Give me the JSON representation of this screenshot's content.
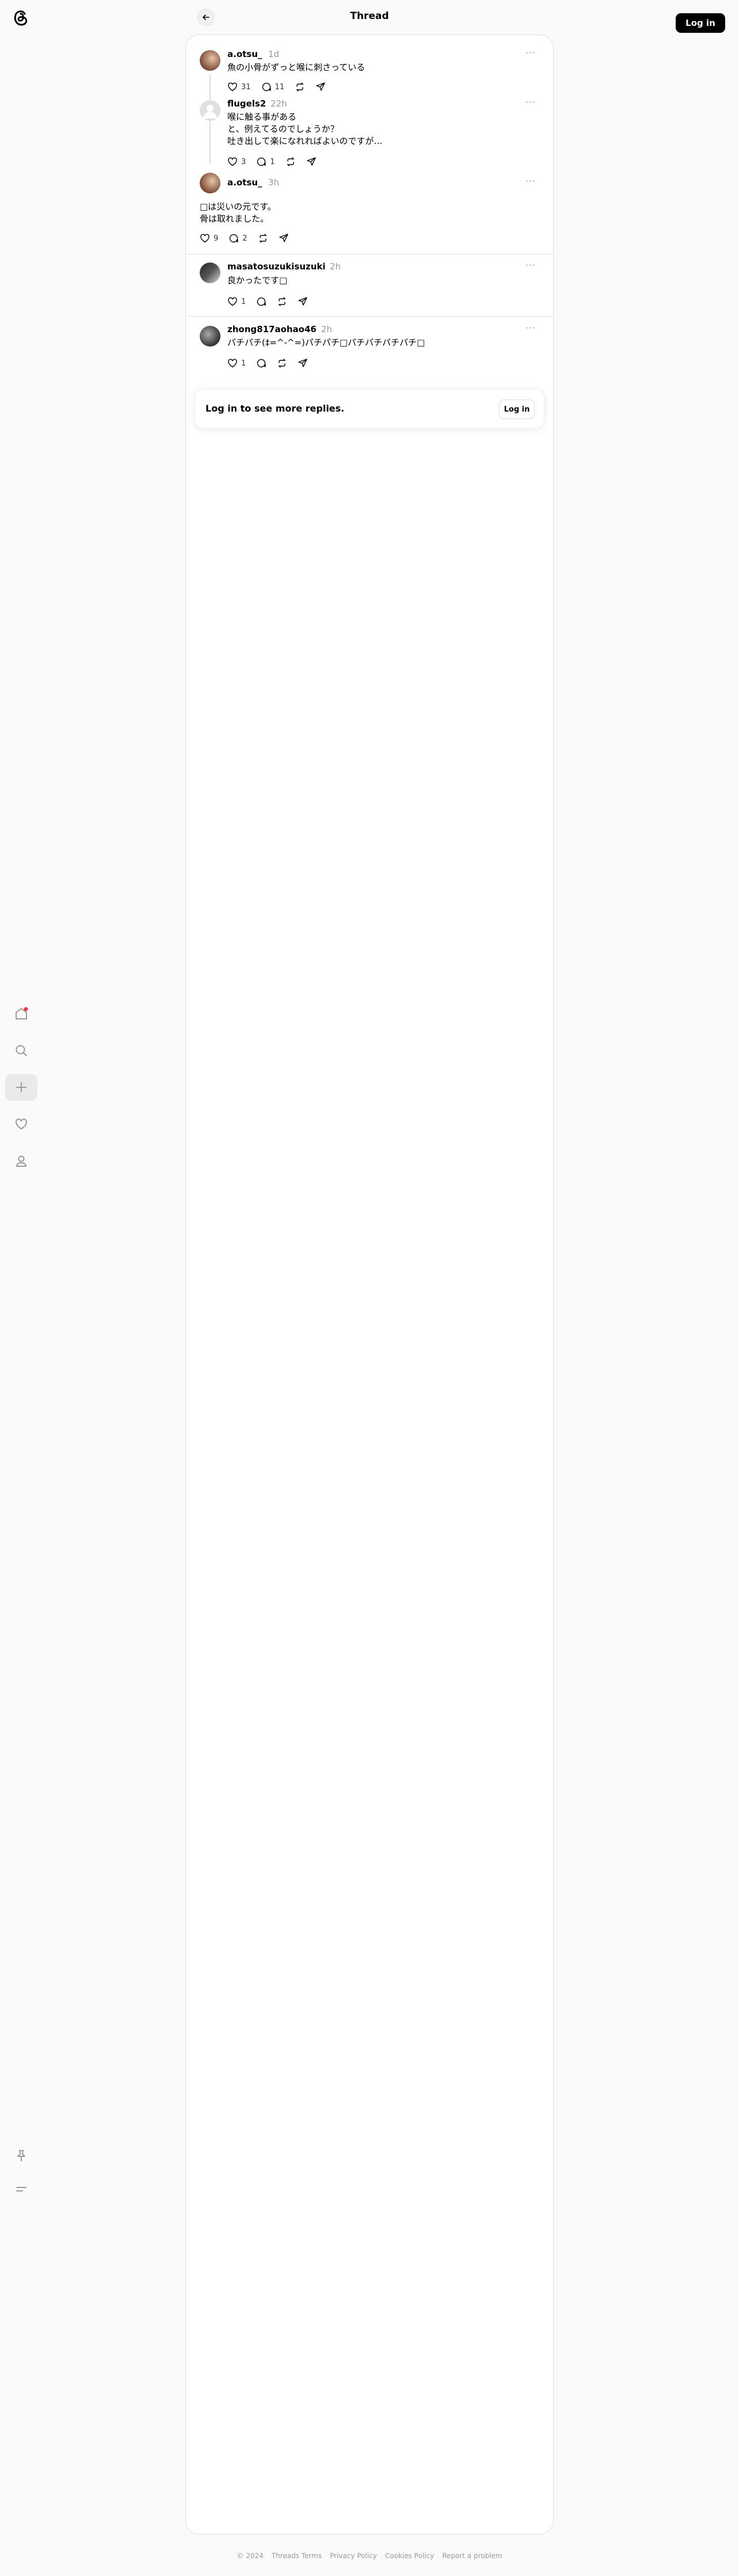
{
  "header": {
    "title": "Thread",
    "login_label": "Log in"
  },
  "posts": [
    {
      "username": "a.otsu_",
      "time": "1d",
      "text": "魚の小骨がずっと喉に刺さっている",
      "likes": "31",
      "replies": "11"
    },
    {
      "username": "flugels2",
      "time": "22h",
      "text": "喉に触る事がある\nと、例えてるのでしょうか？\n吐き出して楽になれればよいのですが…",
      "likes": "3",
      "replies": "1"
    },
    {
      "username": "a.otsu_",
      "time": "3h",
      "text": "□は災いの元です。\n骨は取れました。",
      "likes": "9",
      "replies": "2"
    },
    {
      "username": "masatosuzukisuzuki",
      "time": "2h",
      "text": "良かったです□",
      "likes": "1",
      "replies": ""
    },
    {
      "username": "zhong817aohao46",
      "time": "2h",
      "text": "パチパチ(‡=^-^=)パチパチ□パチパチパチパチ□",
      "likes": "1",
      "replies": ""
    }
  ],
  "login_card": {
    "text": "Log in to see more replies.",
    "button": "Log in"
  },
  "footer": [
    "© 2024",
    "Threads Terms",
    "Privacy Policy",
    "Cookies Policy",
    "Report a problem"
  ],
  "colors": {
    "accent": "#000000",
    "notification_dot": "#ff3040"
  },
  "nav_icons": [
    "home-icon",
    "search-icon",
    "create-icon",
    "heart-icon",
    "profile-icon",
    "pin-icon",
    "menu-icon"
  ]
}
